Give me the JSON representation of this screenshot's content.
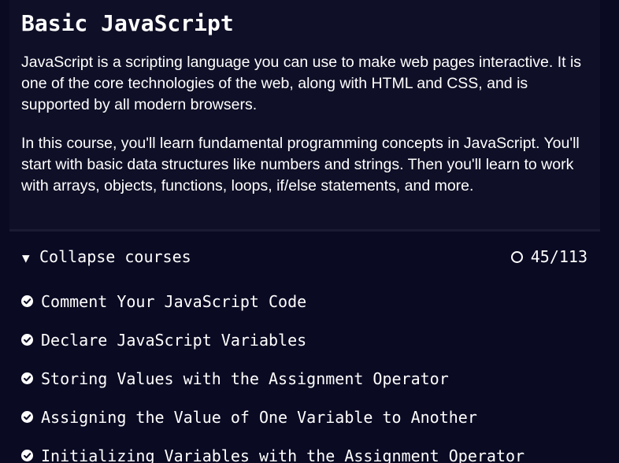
{
  "block": {
    "title": "Basic JavaScript",
    "paragraphs": [
      "JavaScript is a scripting language you can use to make web pages interactive. It is one of the core technologies of the web, along with HTML and CSS, and is supported by all modern browsers.",
      "In this course, you'll learn fundamental programming concepts in JavaScript. You'll start with basic data structures like numbers and strings. Then you'll learn to work with arrays, objects, functions, loops, if/else statements, and more."
    ],
    "toggle_label": "Collapse courses",
    "toggle_icon": "triangle-down-icon",
    "progress_text": "45/113",
    "progress_icon": "circle-outline-icon"
  },
  "lessons": [
    {
      "label": "Comment Your JavaScript Code",
      "completed": true
    },
    {
      "label": "Declare JavaScript Variables",
      "completed": true
    },
    {
      "label": "Storing Values with the Assignment Operator",
      "completed": true
    },
    {
      "label": "Assigning the Value of One Variable to Another",
      "completed": true
    },
    {
      "label": "Initializing Variables with the Assignment Operator",
      "completed": true
    }
  ],
  "colors": {
    "background": "#0a0a23",
    "intro_background": "#0f0f27",
    "divider": "#1b1b32",
    "text": "#ffffff"
  }
}
